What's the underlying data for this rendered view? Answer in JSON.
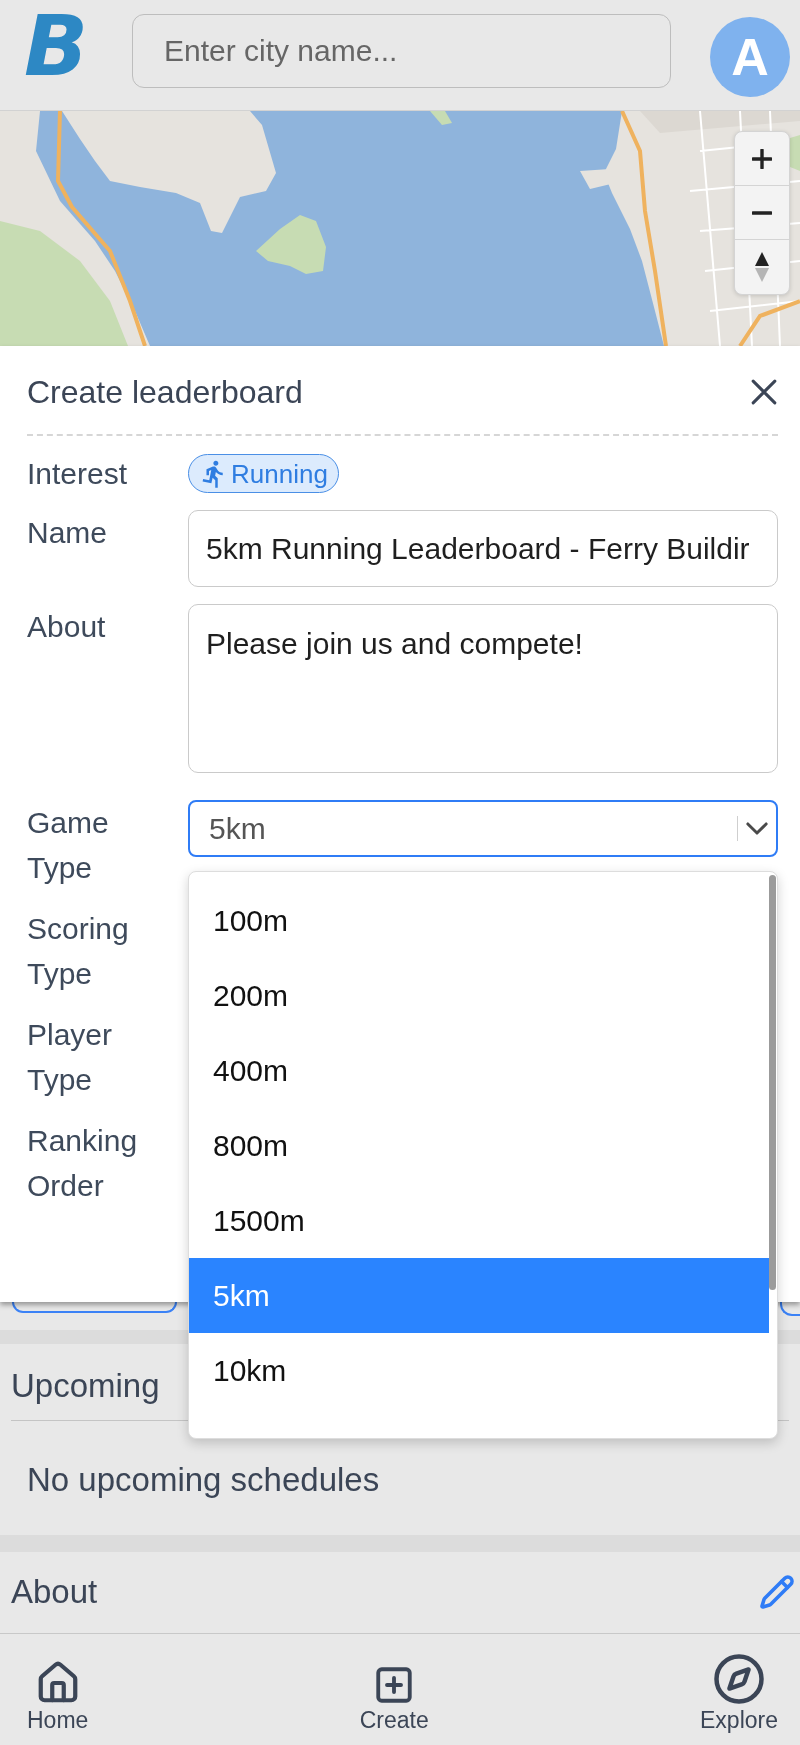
{
  "header": {
    "logo": "B",
    "search": {
      "placeholder": "Enter city name..."
    },
    "avatar": "A"
  },
  "dialog": {
    "title": "Create leaderboard",
    "fields": [
      {
        "label": "Interest",
        "kind": "chip",
        "value": "Running"
      },
      {
        "label": "Name",
        "kind": "text",
        "value": "5km Running Leaderboard - Ferry Buildir"
      },
      {
        "label": "About",
        "kind": "textarea",
        "value": "Please join us and compete!"
      },
      {
        "label": "Game Type",
        "kind": "select",
        "value": "5km",
        "open": true,
        "options": [
          {
            "label": "100m",
            "selected": false
          },
          {
            "label": "200m",
            "selected": false
          },
          {
            "label": "400m",
            "selected": false
          },
          {
            "label": "800m",
            "selected": false
          },
          {
            "label": "1500m",
            "selected": false
          },
          {
            "label": "5km",
            "selected": true
          },
          {
            "label": "10km",
            "selected": false
          }
        ]
      },
      {
        "label": "Scoring Type",
        "kind": "covered"
      },
      {
        "label": "Player Type",
        "kind": "covered"
      },
      {
        "label": "Ranking Order",
        "kind": "covered"
      }
    ]
  },
  "sections": [
    {
      "title": "Upcoming",
      "body": "No upcoming schedules",
      "editable": false
    },
    {
      "title": "About",
      "editable": true
    }
  ],
  "nav": [
    {
      "kind": "home",
      "label": "Home"
    },
    {
      "kind": "create",
      "label": "Create"
    },
    {
      "kind": "explore",
      "label": "Explore"
    }
  ]
}
